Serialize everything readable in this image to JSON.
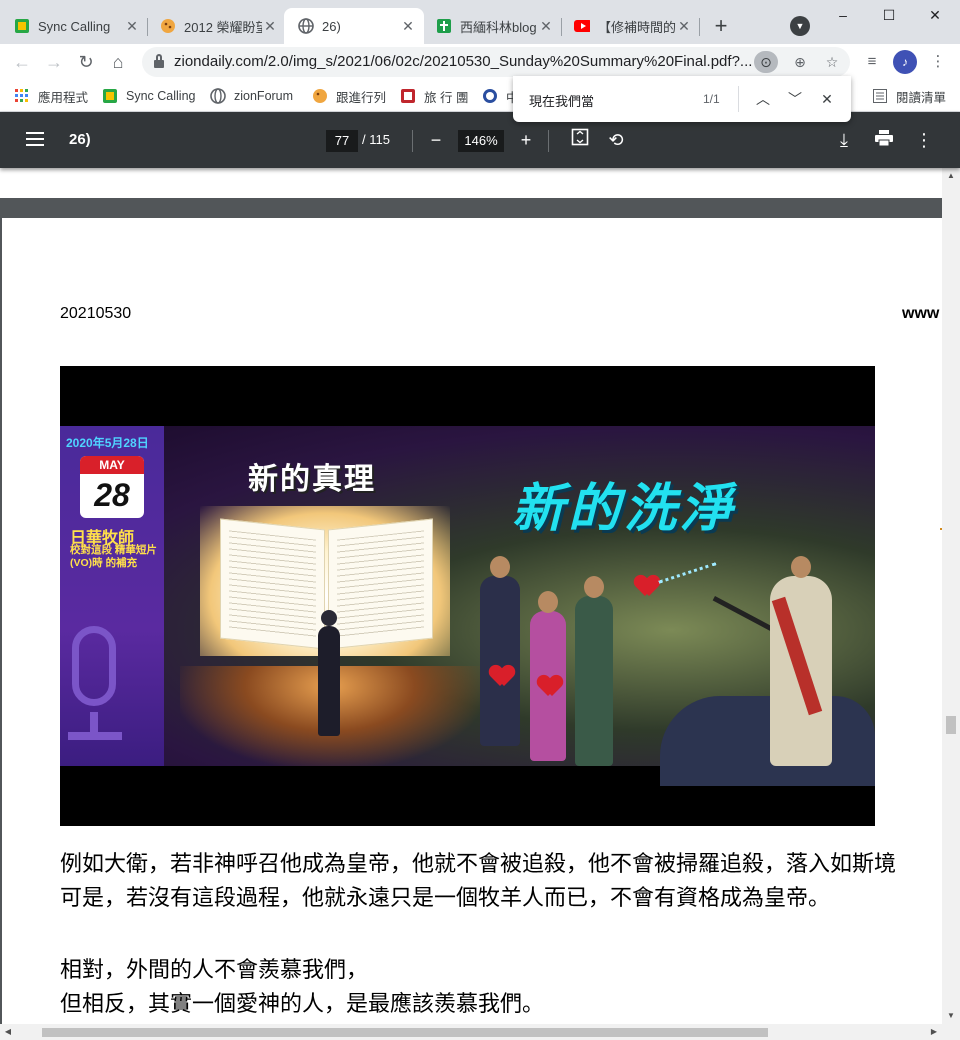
{
  "tabs": [
    {
      "title": "Sync Calling",
      "icon": "sync-calling-icon",
      "active": false
    },
    {
      "title": "2012 榮耀盼望",
      "icon": "cookie-icon",
      "active": false
    },
    {
      "title": "26)",
      "icon": "globe-icon",
      "active": true
    },
    {
      "title": "西緬科林blog",
      "icon": "green-cross-icon",
      "active": false
    },
    {
      "title": "【修補時間的",
      "icon": "youtube-icon",
      "active": false
    }
  ],
  "window": {
    "minimize": "–",
    "maximize": "☐",
    "close": "✕"
  },
  "toolbar": {
    "url": "ziondaily.com/2.0/img_s/2021/06/02c/20210530_Sunday%20Summary%20Final.pdf?..."
  },
  "bookmarks": [
    {
      "label": "應用程式",
      "icon": "apps-grid-icon"
    },
    {
      "label": "Sync Calling",
      "icon": "sync-calling-icon"
    },
    {
      "label": "zionForum",
      "icon": "globe-icon"
    },
    {
      "label": "跟進行列",
      "icon": "cookie-icon"
    },
    {
      "label": "旅 行 團",
      "icon": "seal-icon"
    },
    {
      "label": "中",
      "icon": "clock-icon"
    }
  ],
  "reading_list": "閱讀清單",
  "find": {
    "query": "現在我們當",
    "count": "1/1"
  },
  "pdf": {
    "title": "26)",
    "page_current": "77",
    "page_total": "/ 115",
    "zoom": "146%"
  },
  "page": {
    "date": "20210530",
    "www": "www",
    "banner": {
      "side_date": "2020年5月28日",
      "cal_month": "MAY",
      "cal_day": "28",
      "side_name": "日華牧師",
      "side_desc": "校對這段 精華短片(VO)時 的補充",
      "title_truth": "新的真理",
      "title_wash": "新的洗淨"
    },
    "paragraphs": [
      "例如大衛，若非神呼召他成為皇帝，他就不會被追殺，他不會被掃羅追殺，落入如斯境",
      "可是，若沒有這段過程，他就永遠只是一個牧羊人而已，不會有資格成為皇帝。",
      "相對，外間的人不會羨慕我們，",
      "但相反，其實一個愛神的人，是最應該羨慕我們。"
    ]
  },
  "colors": {
    "accent_cyan": "#22e1f0",
    "pdf_toolbar": "#323639",
    "viewer_bg": "#525659"
  }
}
